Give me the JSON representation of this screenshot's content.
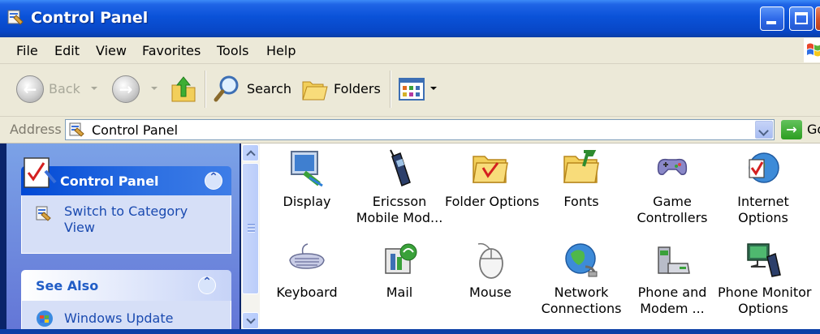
{
  "window": {
    "title": "Control Panel"
  },
  "menu": [
    "File",
    "Edit",
    "View",
    "Favorites",
    "Tools",
    "Help"
  ],
  "toolbar": {
    "back": "Back",
    "search": "Search",
    "folders": "Folders"
  },
  "address": {
    "label": "Address",
    "value": "Control Panel",
    "go": "Go"
  },
  "taskpane": {
    "main_title": "Control Panel",
    "switch_line1": "Switch to Category",
    "switch_line2": "View",
    "see_also_title": "See Also",
    "windows_update": "Windows Update"
  },
  "items": [
    {
      "line1": "Display",
      "line2": ""
    },
    {
      "line1": "Ericsson",
      "line2": "Mobile Mod..."
    },
    {
      "line1": "Folder Options",
      "line2": ""
    },
    {
      "line1": "Fonts",
      "line2": ""
    },
    {
      "line1": "Game",
      "line2": "Controllers"
    },
    {
      "line1": "Internet",
      "line2": "Options"
    },
    {
      "line1": "Keyboard",
      "line2": ""
    },
    {
      "line1": "Mail",
      "line2": ""
    },
    {
      "line1": "Mouse",
      "line2": ""
    },
    {
      "line1": "Network",
      "line2": "Connections"
    },
    {
      "line1": "Phone and",
      "line2": "Modem ..."
    },
    {
      "line1": "Phone Monitor",
      "line2": "Options"
    }
  ],
  "icons": {
    "title": "control-panel-icon",
    "back": "back-arrow-icon",
    "forward": "forward-arrow-icon",
    "up": "up-folder-icon",
    "search": "magnifier-icon",
    "folders": "folders-icon",
    "views": "views-icon"
  }
}
